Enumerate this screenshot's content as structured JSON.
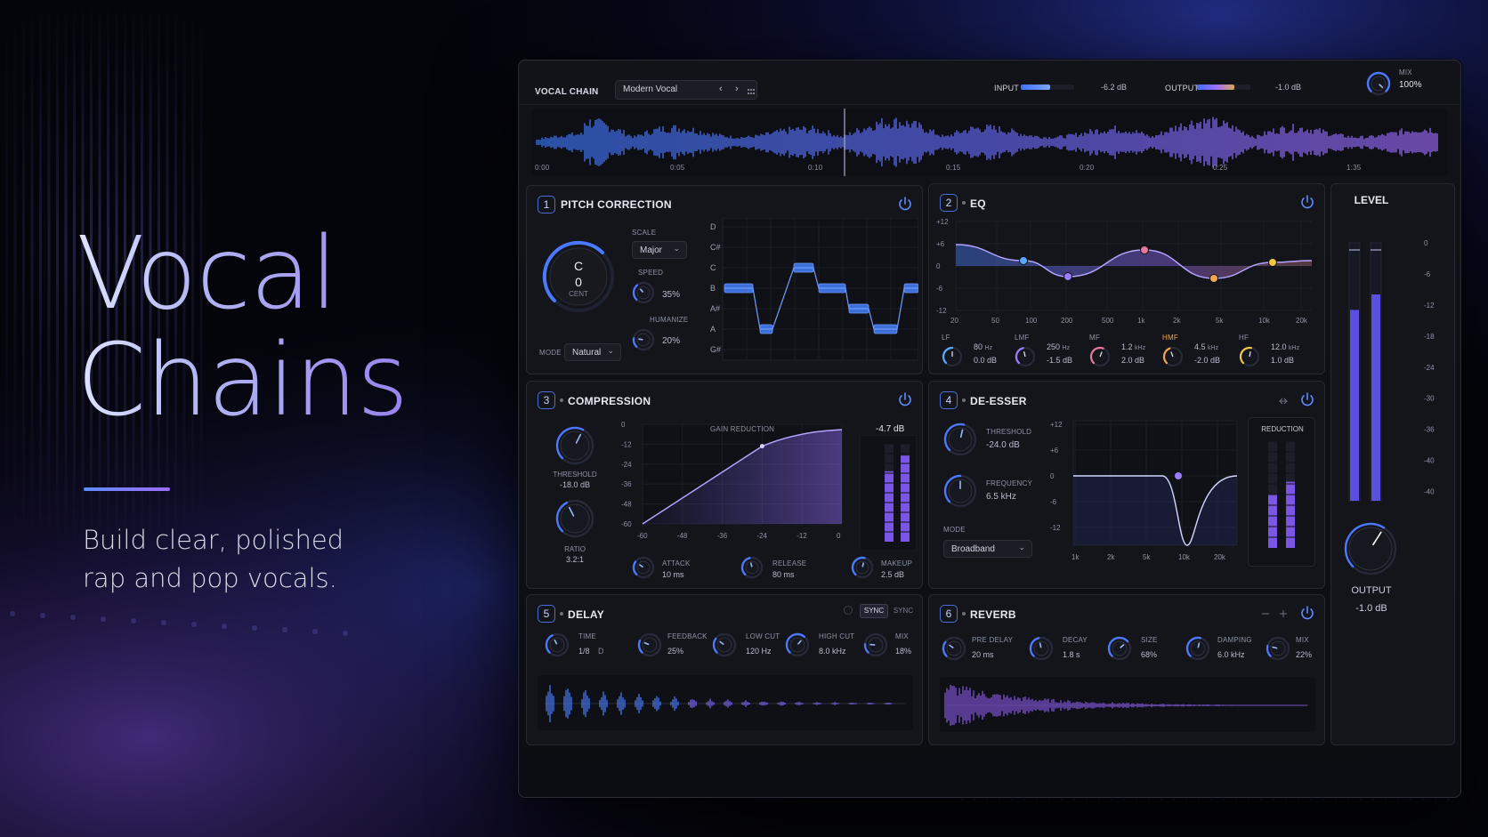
{
  "hero": {
    "title_line1": "Vocal",
    "title_line2": "Chains",
    "subtitle_line1": "Build clear, polished",
    "subtitle_line2": "rap and pop vocals."
  },
  "topbar": {
    "chain_label": "VOCAL CHAIN",
    "preset": "Modern Vocal",
    "prev_icon": "chevron-left-icon",
    "next_icon": "chevron-right-icon",
    "menu_icon": "grid-icon",
    "input_label": "INPUT",
    "input_value": "-6.2 dB",
    "input_level": 0.55,
    "output_label": "OUTPUT",
    "output_value": "-1.0 dB",
    "output_level": 0.7,
    "mix_label": "MIX",
    "mix_value": "100%",
    "mix_level": 1.0
  },
  "timeline": {
    "ticks": [
      "0:00",
      "0:05",
      "0:10",
      "0:15",
      "0:20",
      "0:25",
      "1:35"
    ],
    "playhead_time": "0:09"
  },
  "pitch": {
    "number": "1",
    "title": "PITCH CORRECTION",
    "note": "C",
    "cents": "0",
    "cent_label": "CENT",
    "scale_label": "SCALE",
    "scale_value": "Major",
    "speed_label": "SPEED",
    "speed_value": "35%",
    "speed_level": 0.35,
    "humanize_label": "HUMANIZE",
    "humanize_value": "20%",
    "humanize_level": 0.2,
    "mode_label": "MODE",
    "mode_value": "Natural",
    "notes": [
      "D",
      "C#",
      "C",
      "B",
      "A#",
      "A",
      "G#"
    ]
  },
  "eq": {
    "number": "2",
    "title": "EQ",
    "db_ticks": [
      "+12",
      "+6",
      "0",
      "-6",
      "-12"
    ],
    "freq_ticks": [
      "20",
      "50",
      "100",
      "200",
      "500",
      "1k",
      "2k",
      "5k",
      "10k",
      "20k"
    ],
    "bands": [
      {
        "label": "LF",
        "freq": "80",
        "unit": "Hz",
        "gain": "0.0 dB",
        "color": "#5aa9ff",
        "level": 0.5
      },
      {
        "label": "LMF",
        "freq": "250",
        "unit": "Hz",
        "gain": "-1.5 dB",
        "color": "#9b7dff",
        "level": 0.45
      },
      {
        "label": "MF",
        "freq": "1.2",
        "unit": "kHz",
        "gain": "2.0 dB",
        "color": "#e5799a",
        "level": 0.58
      },
      {
        "label": "HMF",
        "freq": "4.5",
        "unit": "kHz",
        "gain": "-2.0 dB",
        "color": "#f5a64a",
        "level": 0.42
      },
      {
        "label": "HF",
        "freq": "12.0",
        "unit": "kHz",
        "gain": "1.0 dB",
        "color": "#f3c640",
        "level": 0.54
      }
    ]
  },
  "compression": {
    "number": "3",
    "title": "COMPRESSION",
    "gr_label": "GAIN REDUCTION",
    "gr_value": "-4.7 dB",
    "threshold_label": "THRESHOLD",
    "threshold_value": "-18.0 dB",
    "threshold_level": 0.6,
    "ratio_label": "RATIO",
    "ratio_value": "3.2:1",
    "ratio_level": 0.4,
    "attack_label": "ATTACK",
    "attack_value": "10 ms",
    "attack_level": 0.3,
    "release_label": "RELEASE",
    "release_value": "80 ms",
    "release_level": 0.45,
    "makeup_label": "MAKEUP",
    "makeup_value": "2.5 dB",
    "makeup_level": 0.55,
    "y_ticks": [
      "0",
      "-12",
      "-24",
      "-36",
      "-48",
      "-60"
    ],
    "x_ticks": [
      "-60",
      "-48",
      "-36",
      "-24",
      "-12",
      "0"
    ]
  },
  "deesser": {
    "number": "4",
    "title": "DE-ESSER",
    "threshold_label": "THRESHOLD",
    "threshold_value": "-24.0 dB",
    "threshold_level": 0.55,
    "frequency_label": "FREQUENCY",
    "frequency_value": "6.5 kHz",
    "frequency_level": 0.5,
    "mode_label": "MODE",
    "mode_value": "Broadband",
    "reduction_label": "REDUCTION",
    "y_ticks": [
      "+12",
      "+6",
      "0",
      "-6",
      "-12"
    ],
    "x_ticks": [
      "1k",
      "2k",
      "5k",
      "10k",
      "20k"
    ]
  },
  "delay": {
    "number": "5",
    "title": "DELAY",
    "sync_label": "SYNC",
    "sync2_label": "SYNC",
    "time_label": "TIME",
    "time_value": "1/8",
    "time_mode": "D",
    "time_level": 0.4,
    "feedback_label": "FEEDBACK",
    "feedback_value": "25%",
    "feedback_level": 0.25,
    "lowcut_label": "LOW CUT",
    "lowcut_value": "120 Hz",
    "lowcut_level": 0.3,
    "highcut_label": "HIGH CUT",
    "highcut_value": "8.0 kHz",
    "highcut_level": 0.65,
    "mix_label": "MIX",
    "mix_value": "18%",
    "mix_level": 0.18
  },
  "reverb": {
    "number": "6",
    "title": "REVERB",
    "predelay_label": "PRE DELAY",
    "predelay_value": "20 ms",
    "predelay_level": 0.3,
    "decay_label": "DECAY",
    "decay_value": "1.8 s",
    "decay_level": 0.45,
    "size_label": "SIZE",
    "size_value": "68%",
    "size_level": 0.68,
    "damping_label": "DAMPING",
    "damping_value": "6.0 kHz",
    "damping_level": 0.55,
    "mix_label": "MIX",
    "mix_value": "22%",
    "mix_level": 0.22
  },
  "level": {
    "title": "LEVEL",
    "ticks": [
      "0",
      "-6",
      "-12",
      "-18",
      "-24",
      "-30",
      "-36",
      "-40",
      "-40"
    ],
    "output_label": "OUTPUT",
    "output_value": "-1.0 dB",
    "output_level": 0.62
  }
}
